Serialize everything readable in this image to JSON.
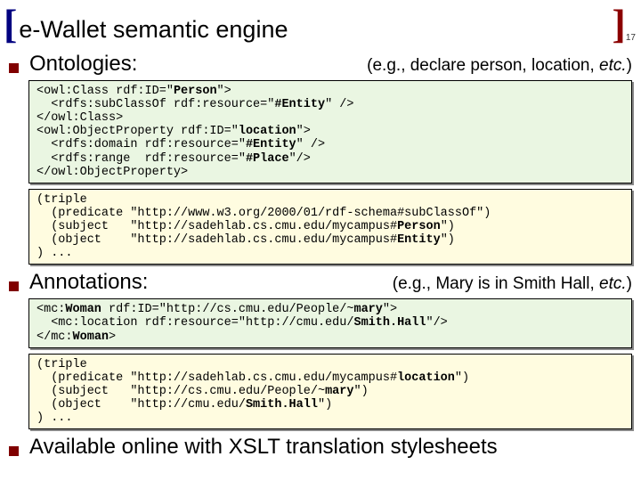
{
  "header": {
    "bracket_left": "[",
    "title": "e-Wallet semantic engine",
    "slide_number": "17",
    "bracket_right": "]"
  },
  "sections": {
    "ontologies": {
      "heading": "Ontologies:",
      "paren_prefix": "(e.g.",
      "paren_body": ", declare person, location, ",
      "paren_suffix": "etc.",
      "paren_close": ")",
      "code_owl": "<owl:Class rdf:ID=\"<b>Person</b>\">\n  <rdfs:subClassOf rdf:resource=\"<b>#Entity</b>\" />\n</owl:Class>\n<owl:ObjectProperty rdf:ID=\"<b>location</b>\">\n  <rdfs:domain rdf:resource=\"<b>#Entity</b>\" />\n  <rdfs:range  rdf:resource=\"<b>#Place</b>\"/>\n</owl:ObjectProperty>",
      "code_triple": "(triple\n  (predicate \"http://www.w3.org/2000/01/rdf-schema#subClassOf\")\n  (subject   \"http://sadehlab.cs.cmu.edu/mycampus#<b>Person</b>\")\n  (object    \"http://sadehlab.cs.cmu.edu/mycampus#<b>Entity</b>\")\n) ..."
    },
    "annotations": {
      "heading": "Annotations:",
      "paren_prefix": "(e.g.",
      "paren_body": ", Mary is in Smith Hall, ",
      "paren_suffix": "etc.",
      "paren_close": ")",
      "code_owl": "<mc:<b>Woman</b> rdf:ID=\"http://cs.cmu.edu/People/~<b>mary</b>\">\n  <mc:location rdf:resource=\"http://cmu.edu/<b>Smith.Hall</b>\"/>\n</mc:<b>Woman</b>>",
      "code_triple": "(triple\n  (predicate \"http://sadehlab.cs.cmu.edu/mycampus#<b>location</b>\")\n  (subject   \"http://cs.cmu.edu/People/~<b>mary</b>\")\n  (object    \"http://cmu.edu/<b>Smith.Hall</b>\")\n) ..."
    },
    "closing": {
      "text": "Available online with XSLT translation stylesheets"
    }
  }
}
